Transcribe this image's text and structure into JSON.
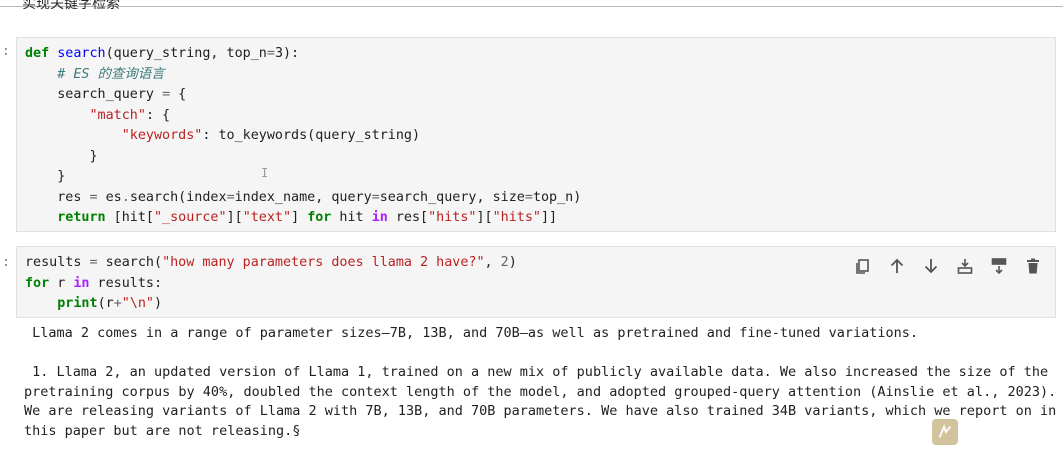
{
  "heading_fragment": "实现关键字检索",
  "cell1": {
    "prompt": ":",
    "lines": [
      [
        {
          "t": "def",
          "c": "kw"
        },
        {
          "t": " "
        },
        {
          "t": "search",
          "c": "nf"
        },
        {
          "t": "(query_string, top_n"
        },
        {
          "t": "=",
          "c": "op"
        },
        {
          "t": "3):"
        }
      ],
      [
        {
          "t": "    "
        },
        {
          "t": "# ES 的查询语言",
          "c": "cm"
        }
      ],
      [
        {
          "t": "    search_query "
        },
        {
          "t": "=",
          "c": "op"
        },
        {
          "t": " {"
        }
      ],
      [
        {
          "t": "        "
        },
        {
          "t": "\"match\"",
          "c": "s"
        },
        {
          "t": ": {"
        }
      ],
      [
        {
          "t": "            "
        },
        {
          "t": "\"keywords\"",
          "c": "s"
        },
        {
          "t": ": to_keywords(query_string)"
        }
      ],
      [
        {
          "t": "        }"
        }
      ],
      [
        {
          "t": "    }"
        }
      ],
      [
        {
          "t": "    res "
        },
        {
          "t": "=",
          "c": "op"
        },
        {
          "t": " es"
        },
        {
          "t": ".",
          "c": "op"
        },
        {
          "t": "search(index"
        },
        {
          "t": "=",
          "c": "op"
        },
        {
          "t": "index_name, query"
        },
        {
          "t": "=",
          "c": "op"
        },
        {
          "t": "search_query, size"
        },
        {
          "t": "=",
          "c": "op"
        },
        {
          "t": "top_n)"
        }
      ],
      [
        {
          "t": "    "
        },
        {
          "t": "return",
          "c": "kw"
        },
        {
          "t": " [hit["
        },
        {
          "t": "\"_source\"",
          "c": "s"
        },
        {
          "t": "]["
        },
        {
          "t": "\"text\"",
          "c": "s"
        },
        {
          "t": "] "
        },
        {
          "t": "for",
          "c": "kw"
        },
        {
          "t": " hit "
        },
        {
          "t": "in",
          "c": "ow"
        },
        {
          "t": " res["
        },
        {
          "t": "\"hits\"",
          "c": "s"
        },
        {
          "t": "]["
        },
        {
          "t": "\"hits\"",
          "c": "s"
        },
        {
          "t": "]]"
        }
      ]
    ]
  },
  "cell2": {
    "prompt": ":",
    "lines": [
      [
        {
          "t": "results "
        },
        {
          "t": "=",
          "c": "op"
        },
        {
          "t": " search("
        },
        {
          "t": "\"how many parameters does llama 2 have?\"",
          "c": "s"
        },
        {
          "t": ", "
        },
        {
          "t": "2",
          "c": "op"
        },
        {
          "t": ")"
        }
      ],
      [
        {
          "t": "for",
          "c": "kw"
        },
        {
          "t": " r "
        },
        {
          "t": "in",
          "c": "ow"
        },
        {
          "t": " results:"
        }
      ],
      [
        {
          "t": "    "
        },
        {
          "t": "print",
          "c": "kw"
        },
        {
          "t": "(r"
        },
        {
          "t": "+",
          "c": "op"
        },
        {
          "t": "\"\\n\"",
          "c": "s"
        },
        {
          "t": ")"
        }
      ]
    ],
    "toolbar": [
      {
        "name": "duplicate-cell-button",
        "icon": "copy-icon"
      },
      {
        "name": "move-up-button",
        "icon": "arrow-up-icon"
      },
      {
        "name": "move-down-button",
        "icon": "arrow-down-icon"
      },
      {
        "name": "insert-above-button",
        "icon": "insert-above-icon"
      },
      {
        "name": "insert-below-button",
        "icon": "insert-below-icon"
      },
      {
        "name": "delete-cell-button",
        "icon": "trash-icon"
      }
    ]
  },
  "output_text": " Llama 2 comes in a range of parameter sizes—7B, 13B, and 70B—as well as pretrained and fine-tuned variations.\n\n 1. Llama 2, an updated version of Llama 1, trained on a new mix of publicly available data. We also increased the size of the\npretraining corpus by 40%, doubled the context length of the model, and adopted grouped-query attention (Ainslie et al., 2023).\nWe are releasing variants of Llama 2 with 7B, 13B, and 70B parameters. We have also trained 34B variants, which we report on in\nthis paper but are not releasing.§",
  "text_cursor_glyph": "I"
}
